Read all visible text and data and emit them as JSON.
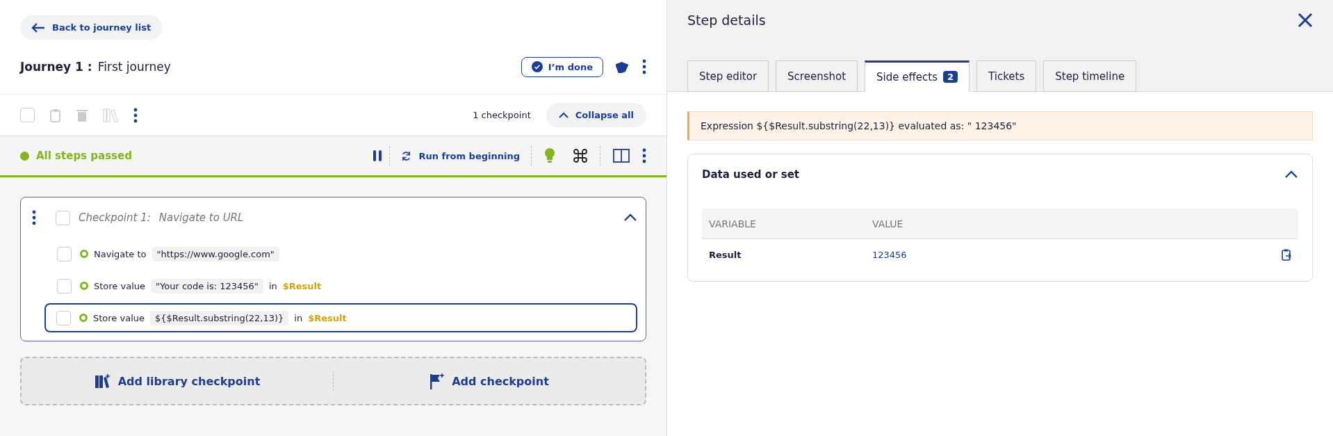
{
  "left": {
    "back_button": "Back to journey list",
    "journey": {
      "label": "Journey 1 :",
      "name": "First journey",
      "done_button": "I’m done"
    },
    "toolbar": {
      "select_all_checked": false,
      "count": "1 checkpoint",
      "collapse_button": "Collapse all"
    },
    "run_bar": {
      "status": "All steps passed",
      "passed": true,
      "run_button": "Run from beginning"
    },
    "checkpoint": {
      "label": "Checkpoint 1:",
      "name": "Navigate to URL",
      "checked": false,
      "expanded": true,
      "steps": [
        {
          "action": "Navigate to",
          "value": "\"https://www.google.com\"",
          "checked": false,
          "selected": false,
          "passed": true
        },
        {
          "action": "Store value",
          "value": "\"Your code is: 123456\"",
          "in": "in",
          "variable": "$Result",
          "checked": false,
          "selected": false,
          "passed": true
        },
        {
          "action": "Store value",
          "value": "${$Result.substring(22,13)}",
          "in": "in",
          "variable": "$Result",
          "checked": false,
          "selected": true,
          "passed": true
        }
      ]
    },
    "add_bar": {
      "library_button": "Add library checkpoint",
      "checkpoint_button": "Add checkpoint"
    }
  },
  "panel": {
    "title": "Step details",
    "tabs": [
      {
        "label": "Step editor",
        "selected": false
      },
      {
        "label": "Screenshot",
        "selected": false
      },
      {
        "label": "Side effects",
        "badge": "2",
        "selected": true
      },
      {
        "label": "Tickets",
        "selected": false
      },
      {
        "label": "Step timeline",
        "selected": false
      }
    ],
    "alert": "Expression ${$Result.substring(22,13)} evaluated as: \" 123456\"",
    "data_card": {
      "title": "Data used or set",
      "expanded": true,
      "columns": [
        "VARIABLE",
        "VALUE"
      ],
      "rows": [
        {
          "variable": "Result",
          "value": "123456"
        }
      ]
    }
  }
}
